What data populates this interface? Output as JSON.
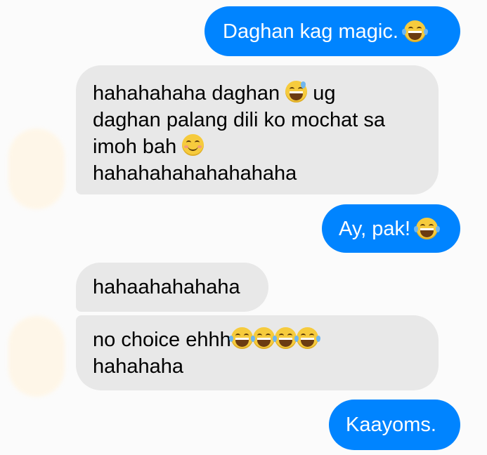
{
  "conversation": {
    "messages": [
      {
        "direction": "outgoing",
        "text": "Daghan kag magic.",
        "emoji": "face-with-tears-of-joy"
      },
      {
        "direction": "incoming",
        "lines": [
          "hahahahaha daghan",
          "ug",
          "daghan palang dili ko mochat sa",
          "imoh bah",
          "hahahahahahahahaha"
        ],
        "emojis": [
          "grinning-face-with-sweat",
          "smiling-face-with-smiling-eyes"
        ]
      },
      {
        "direction": "outgoing",
        "text": "Ay, pak!",
        "emoji": "face-with-tears-of-joy"
      },
      {
        "direction": "incoming",
        "text": "hahaahahahaha"
      },
      {
        "direction": "incoming",
        "lines": [
          "no choice ehhh",
          "hahahaha"
        ],
        "emoji": "face-with-tears-of-joy",
        "emoji_count": 4
      },
      {
        "direction": "outgoing",
        "text": "Kaayoms."
      }
    ]
  },
  "colors": {
    "outgoing_bubble": "#0084ff",
    "incoming_bubble": "#e8e8e8",
    "background": "#fbfbfb"
  }
}
